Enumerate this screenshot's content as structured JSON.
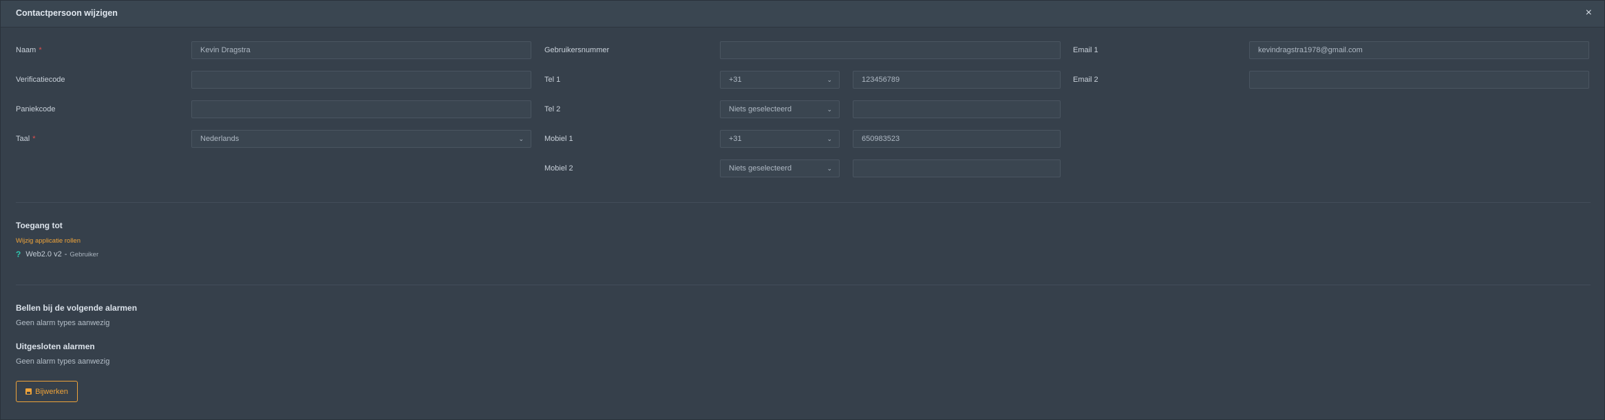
{
  "modal": {
    "title": "Contactpersoon wijzigen",
    "close_symbol": "×"
  },
  "form": {
    "naam": {
      "label": "Naam",
      "required": "*",
      "value": "Kevin Dragstra"
    },
    "verificatiecode": {
      "label": "Verificatiecode",
      "value": ""
    },
    "paniekcode": {
      "label": "Paniekcode",
      "value": ""
    },
    "taal": {
      "label": "Taal",
      "required": "*",
      "value": "Nederlands"
    },
    "gebruikersnummer": {
      "label": "Gebruikersnummer",
      "value": ""
    },
    "tel1": {
      "label": "Tel 1",
      "country": "+31",
      "number": "123456789"
    },
    "tel2": {
      "label": "Tel 2",
      "country": "Niets geselecteerd",
      "number": ""
    },
    "mobiel1": {
      "label": "Mobiel 1",
      "country": "+31",
      "number": "650983523"
    },
    "mobiel2": {
      "label": "Mobiel 2",
      "country": "Niets geselecteerd",
      "number": ""
    },
    "email1": {
      "label": "Email 1",
      "value": "kevindragstra1978@gmail.com"
    },
    "email2": {
      "label": "Email 2",
      "value": ""
    }
  },
  "access": {
    "heading": "Toegang tot",
    "edit_link": "Wijzig applicatie rollen",
    "role_icon": "question-icon",
    "role_name": "Web2.0 v2",
    "role_separator": "-",
    "role_type": "Gebruiker"
  },
  "alarms": {
    "call_heading": "Bellen bij de volgende alarmen",
    "call_text": "Geen alarm types aanwezig",
    "excluded_heading": "Uitgesloten alarmen",
    "excluded_text": "Geen alarm types aanwezig"
  },
  "actions": {
    "save_label": "Bijwerken",
    "save_icon": "save-icon"
  },
  "colors": {
    "accent": "#f0a43a",
    "required": "#e24f4f",
    "role_icon": "#2fc7b0",
    "background": "#36404b"
  }
}
